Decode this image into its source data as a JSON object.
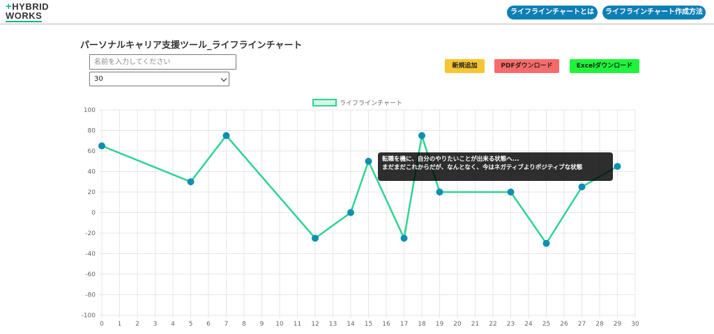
{
  "header": {
    "logo_line1_plus": "+",
    "logo_line1": "HYBRID",
    "logo_line2": "WORKS",
    "nav": [
      {
        "label": "ライフラインチャートとは"
      },
      {
        "label": "ライフラインチャート作成方法"
      }
    ]
  },
  "page_title": "パーソナルキャリア支援ツール_ライフラインチャート",
  "form": {
    "name_placeholder": "名前を入力してください",
    "age_selected": "30"
  },
  "actions": {
    "new_label": "新規追加",
    "pdf_label": "PDFダウンロード",
    "excel_label": "Excelダウンロード"
  },
  "colors": {
    "line": "#2dd391",
    "point": "#0e8fb0",
    "legend_fill": "#d3f6e6"
  },
  "chart_data": {
    "type": "line",
    "legend": [
      "ライフラインチャート"
    ],
    "legend_position": "top",
    "grid": true,
    "xlim": [
      0,
      30
    ],
    "ylim": [
      -100,
      100
    ],
    "x_ticks": [
      0,
      1,
      2,
      3,
      4,
      5,
      6,
      7,
      8,
      9,
      10,
      11,
      12,
      13,
      14,
      15,
      16,
      17,
      18,
      19,
      20,
      21,
      22,
      23,
      24,
      25,
      26,
      27,
      28,
      29,
      30
    ],
    "y_ticks": [
      100,
      80,
      60,
      40,
      20,
      0,
      -20,
      -40,
      -60,
      -80,
      -100
    ],
    "series": [
      {
        "name": "ライフラインチャート",
        "x": [
          0,
          5,
          7,
          12,
          14,
          15,
          17,
          18,
          19,
          23,
          25,
          27,
          29
        ],
        "y": [
          65,
          30,
          75,
          -25,
          0,
          50,
          -25,
          75,
          20,
          20,
          -30,
          25,
          45
        ]
      }
    ],
    "tooltip": {
      "line1": "転職を機に、自分のやりたいことが出来る状態へ...",
      "line2": "まだまだこれからだが、なんとなく、今はネガティブよりポジティブな状態"
    }
  }
}
